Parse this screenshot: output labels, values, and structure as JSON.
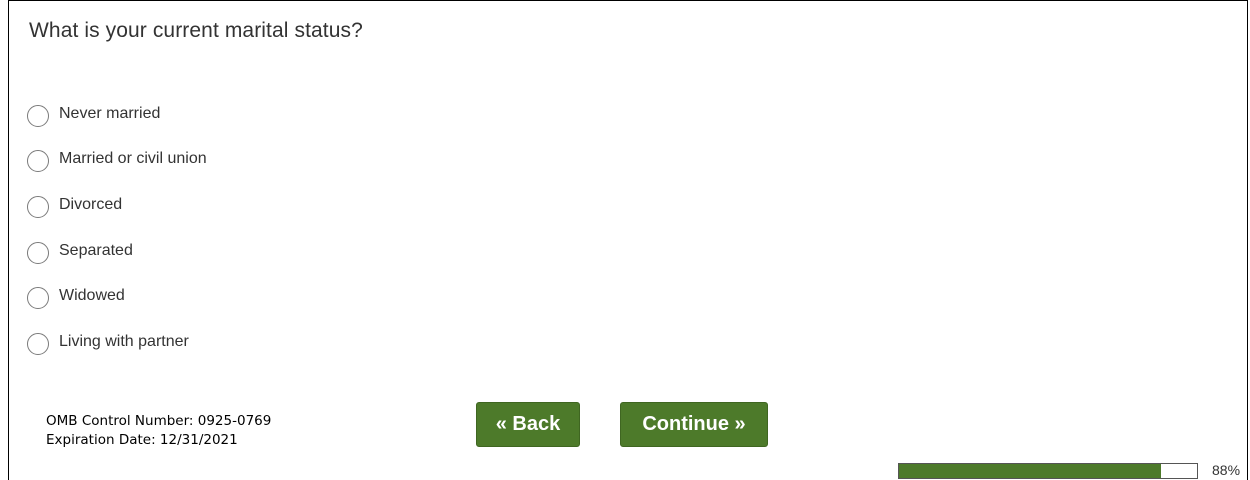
{
  "question": "What is your current marital status?",
  "options": [
    {
      "label": "Never married",
      "selected": false
    },
    {
      "label": "Married or civil union",
      "selected": false
    },
    {
      "label": "Divorced",
      "selected": false
    },
    {
      "label": "Separated",
      "selected": false
    },
    {
      "label": "Widowed",
      "selected": false
    },
    {
      "label": "Living with partner",
      "selected": false
    }
  ],
  "footer": {
    "omb_control": "OMB Control Number: 0925-0769",
    "expiration": "Expiration Date: 12/31/2021"
  },
  "buttons": {
    "back_label": "« Back",
    "continue_label": "Continue »"
  },
  "progress": {
    "value": 0.88,
    "text": "88%"
  },
  "colors": {
    "accent": "#4d7a2a",
    "text": "#333333"
  },
  "icons": {
    "radio": "radio-unchecked-icon"
  }
}
